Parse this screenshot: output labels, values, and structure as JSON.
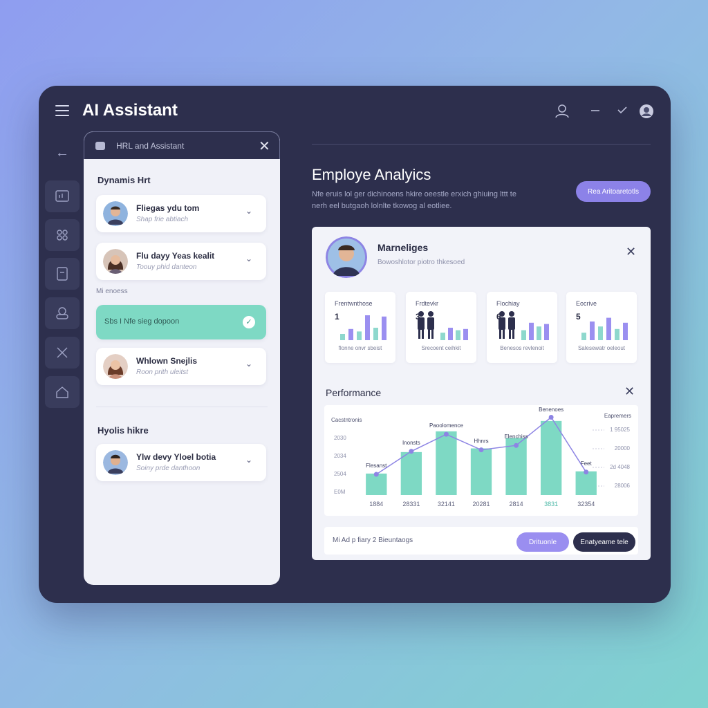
{
  "header": {
    "title": "AI Assistant"
  },
  "chat": {
    "header_title": "HRL and Assistant",
    "close": "✕",
    "section_dynamic": "Dynamis Hrt",
    "items_top": [
      {
        "name": "Fliegas ydu tom",
        "sub": "Shap frie abtiach"
      },
      {
        "name": "Flu dayy Yeas kealit",
        "sub": "Toouy phid danteon"
      }
    ],
    "mini_label": "Mi enoess",
    "active_message": "Sbs I Nfe sieg dopoon",
    "active_check": "✓",
    "item_mid": {
      "name": "Whlown Snejlis",
      "sub": "Roon prith uleitst"
    },
    "section_bottom": "Hyolis hikre",
    "item_bottom": {
      "name": "Ylw devy Yloel botia",
      "sub": "Soiny prde danthoon"
    }
  },
  "main": {
    "title": "Employe Analyics",
    "desc": "Nfe eruis lol ger dichinoens hkire oeestle erxich ghiuing lttt te nerh eel butgaoh lolnlte tkowog al eotliee.",
    "cta": "Rea Aritoaretotls"
  },
  "profile": {
    "name": "Marneliges",
    "sub": "Bowoshlotor piotro thkesoed",
    "close": "✕"
  },
  "stats": [
    {
      "label": "Frentwnthose",
      "value": "1",
      "caption": "flonne onvr sbeist",
      "bars": [
        0.25,
        0.45,
        0.35,
        1.0,
        0.5,
        0.95
      ]
    },
    {
      "label": "Frdtevkr",
      "value": "3",
      "caption": "Srecoent ceihkit",
      "bars": [
        0.3,
        0.5,
        0.4,
        0.45
      ]
    },
    {
      "label": "Flochiay",
      "value": "6",
      "caption": "Benesos revlenoit",
      "bars": [
        0.4,
        0.7,
        0.55,
        0.65
      ]
    },
    {
      "label": "Eocrive",
      "value": "5",
      "caption": "Salesewatr oeleout",
      "bars": [
        0.3,
        0.75,
        0.55,
        0.9,
        0.45,
        0.7
      ]
    }
  ],
  "performance": {
    "title": "Performance",
    "close": "✕"
  },
  "chart_data": {
    "type": "bar",
    "categories": [
      "1884",
      "28331",
      "32141",
      "20281",
      "2814",
      "3831",
      "32354"
    ],
    "values": [
      1450,
      2900,
      4300,
      3150,
      3850,
      5000,
      1600
    ],
    "line_values": [
      1400,
      2950,
      4100,
      3050,
      3350,
      5250,
      1550
    ],
    "ylim": [
      0,
      5600
    ],
    "y_ticks_left": [
      "2030",
      "2034",
      "2504",
      "E0M"
    ],
    "y_ticks_left_title": "Cacstntronis",
    "y_ticks_right_title": "Eapremers",
    "y_ticks_right": [
      "1 95025",
      "20000",
      "2d 4048",
      "28006"
    ],
    "annotations": [
      "Flesanst",
      "Inonsts",
      "Paoolomence",
      "Hhnrs",
      "Elenchiss",
      "Benenoes",
      "Feet"
    ],
    "colors": {
      "bar": "#7ed9c4",
      "line": "#8d84e4",
      "point": "#8d84e4"
    }
  },
  "footer": {
    "text": "Mi Ad p fiary 2 Bieuntaogs",
    "btn_primary": "Drituonle",
    "btn_secondary": "Enatyeame tele"
  },
  "colors": {
    "accent": "#8c82e8",
    "teal": "#7ed9c4",
    "navy": "#2d2f4d"
  }
}
